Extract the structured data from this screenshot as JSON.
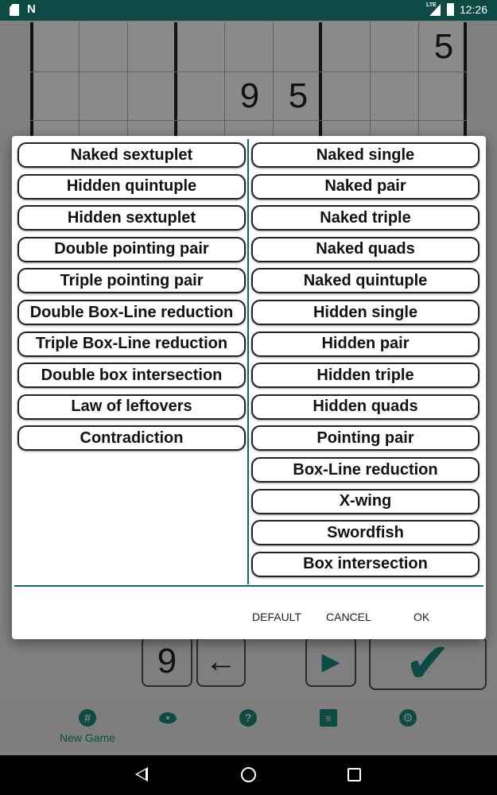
{
  "status_bar": {
    "left_icons": [
      "sd-card-icon",
      "n-notification-icon"
    ],
    "network": "LTE",
    "time": "12:26"
  },
  "board_digits": [
    {
      "row": 0,
      "col": 8,
      "value": "5"
    },
    {
      "row": 1,
      "col": 4,
      "value": "9"
    },
    {
      "row": 1,
      "col": 5,
      "value": "5"
    }
  ],
  "controls": {
    "digit": "9",
    "back_arrow": "←",
    "play": "▶",
    "check": "✔"
  },
  "bottom_nav": {
    "items": [
      {
        "label": "New Game",
        "icon": "grid-icon"
      },
      {
        "label": "",
        "icon": "eye-icon"
      },
      {
        "label": "",
        "icon": "help-icon"
      },
      {
        "label": "",
        "icon": "list-icon"
      },
      {
        "label": "",
        "icon": "gear-icon"
      }
    ]
  },
  "dialog": {
    "left_options": [
      "Naked sextuplet",
      "Hidden quintuple",
      "Hidden sextuplet",
      "Double pointing pair",
      "Triple pointing pair",
      "Double Box-Line reduction",
      "Triple Box-Line reduction",
      "Double box intersection",
      "Law of leftovers",
      "Contradiction"
    ],
    "right_options": [
      "Naked single",
      "Naked pair",
      "Naked triple",
      "Naked quads",
      "Naked quintuple",
      "Hidden single",
      "Hidden pair",
      "Hidden triple",
      "Hidden quads",
      "Pointing pair",
      "Box-Line reduction",
      "X-wing",
      "Swordfish",
      "Box intersection"
    ],
    "buttons": {
      "default": "DEFAULT",
      "cancel": "CANCEL",
      "ok": "OK"
    }
  },
  "colors": {
    "accent": "#0d6b61",
    "status_bar": "#0d4a43",
    "dim_background": "#808080"
  }
}
